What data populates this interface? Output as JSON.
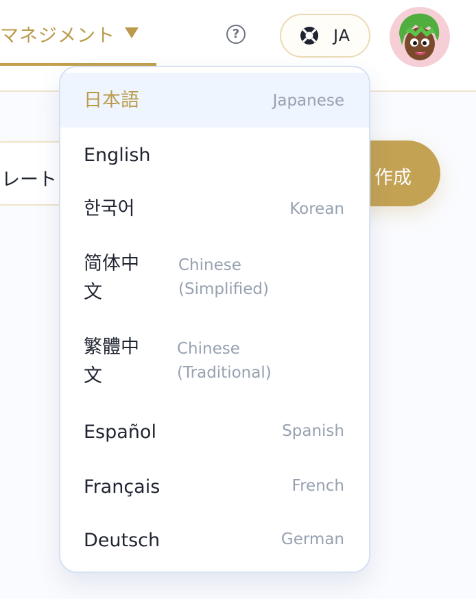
{
  "header": {
    "nav_tab_label": "マネジメント",
    "language_button_label": "JA",
    "help_symbol": "?"
  },
  "toolbar": {
    "template_button_label": "レート",
    "create_button_label": "作成"
  },
  "language_menu": {
    "items": [
      {
        "native": "日本語",
        "english": "Japanese",
        "selected": true
      },
      {
        "native": "English",
        "english": "",
        "selected": false
      },
      {
        "native": "한국어",
        "english": "Korean",
        "selected": false
      },
      {
        "native": "简体中文",
        "english": "Chinese (Simplified)",
        "selected": false
      },
      {
        "native": "繁體中文",
        "english": "Chinese (Traditional)",
        "selected": false
      },
      {
        "native": "Español",
        "english": "Spanish",
        "selected": false
      },
      {
        "native": "Français",
        "english": "French",
        "selected": false
      },
      {
        "native": "Deutsch",
        "english": "German",
        "selected": false
      }
    ]
  },
  "colors": {
    "accent_gold": "#c2a04e",
    "selected_bg": "#eef5fe",
    "secondary_text": "#97a1b1"
  },
  "icons": {
    "language": "lifebuoy-icon",
    "help": "question-circle-icon",
    "caret": "caret-down-icon"
  }
}
